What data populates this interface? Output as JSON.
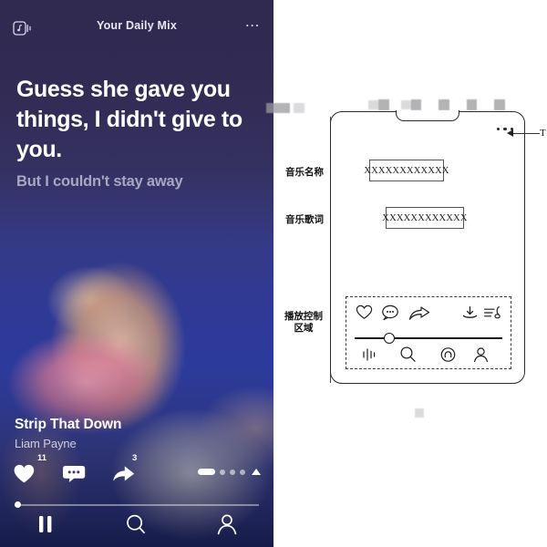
{
  "left_app": {
    "header": {
      "logo_icon": "music-card-icon",
      "title": "Your Daily Mix",
      "more_icon": "more-horizontal-icon",
      "more_label": "⋯"
    },
    "lyrics": {
      "active_line": "Guess she gave you things, I didn't give to you.",
      "next_line": "But I couldn't stay away"
    },
    "now_playing": {
      "track_title": "Strip That Down",
      "artist": "Liam Payne"
    },
    "actions": {
      "like": {
        "icon": "heart-filled-icon",
        "count": "11"
      },
      "comment": {
        "icon": "comment-bubble-icon",
        "count": ""
      },
      "share": {
        "icon": "share-arrow-icon",
        "count": "3"
      }
    },
    "pager": {
      "active_icon": "page-indicator-pill",
      "dots": 3,
      "expand_icon": "chevron-up-icon"
    },
    "progress": {
      "percent": 2
    },
    "bottom_nav": [
      {
        "icon": "pause-icon",
        "name": "pause-button"
      },
      {
        "icon": "search-icon",
        "name": "search-button"
      },
      {
        "icon": "profile-icon",
        "name": "profile-button"
      }
    ]
  },
  "right_diagram": {
    "labels": {
      "music_name": "音乐名称",
      "music_lyrics": "音乐歌词",
      "playback_control_area": "播放控制\n区域",
      "edge_label": "T"
    },
    "boxes": {
      "music_name_value": "XXXXXXXXXXXX",
      "music_lyrics_value": "XXXXXXXXXXXX"
    },
    "phone": {
      "frame_dots_icon": "more-horizontal-icon",
      "control_icons_top": [
        "heart-outline-icon",
        "comment-bubble-icon",
        "share-arrow-icon",
        "download-icon",
        "playlist-note-icon"
      ],
      "control_icons_bottom": [
        "equalizer-pause-icon",
        "search-icon",
        "headphone-record-icon",
        "person-icon"
      ]
    }
  }
}
